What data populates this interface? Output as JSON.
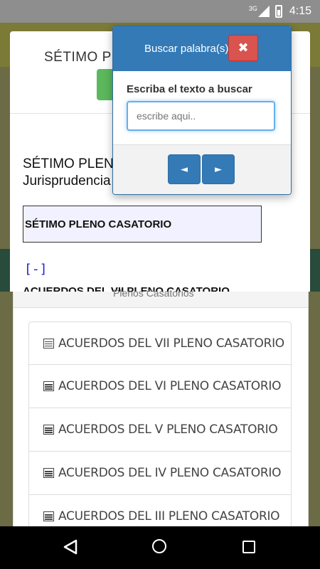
{
  "status_bar": {
    "network": "3G",
    "time": "4:15",
    "icons": [
      "signal-icon",
      "battery-icon"
    ]
  },
  "card": {
    "title": "SÉTIMO PLEN",
    "content_title": "SÉTIMO PLEN",
    "content_subtitle": "Jurisprudencia",
    "boxed_heading": "SÉTIMO PLENO CASATORIO",
    "collapse_link": "[-]",
    "cut_heading": "ACUERDOS DEL VII PLENO CASATORIO"
  },
  "list_panel": {
    "header": "Plenos Casatorios",
    "items": [
      {
        "label": "ACUERDOS DEL VII PLENO CASATORIO",
        "icon": "list-icon"
      },
      {
        "label": "ACUERDOS DEL VI PLENO CASATORIO",
        "icon": "list-icon"
      },
      {
        "label": "ACUERDOS DEL V PLENO CASATORIO",
        "icon": "list-icon"
      },
      {
        "label": "ACUERDOS DEL IV PLENO CASATORIO",
        "icon": "list-icon"
      },
      {
        "label": "ACUERDOS DEL III PLENO CASATORIO",
        "icon": "list-icon"
      }
    ]
  },
  "dialog": {
    "title": "Buscar palabra(s)",
    "close_label": "✖",
    "label": "Escriba el texto a buscar",
    "input_placeholder": "escribe aqui..",
    "input_value": "",
    "prev_label": "◄",
    "next_label": "►"
  },
  "colors": {
    "primary": "#337ab7",
    "danger": "#d9534f",
    "success": "#5cb85c",
    "input_focus": "#66afe9"
  }
}
